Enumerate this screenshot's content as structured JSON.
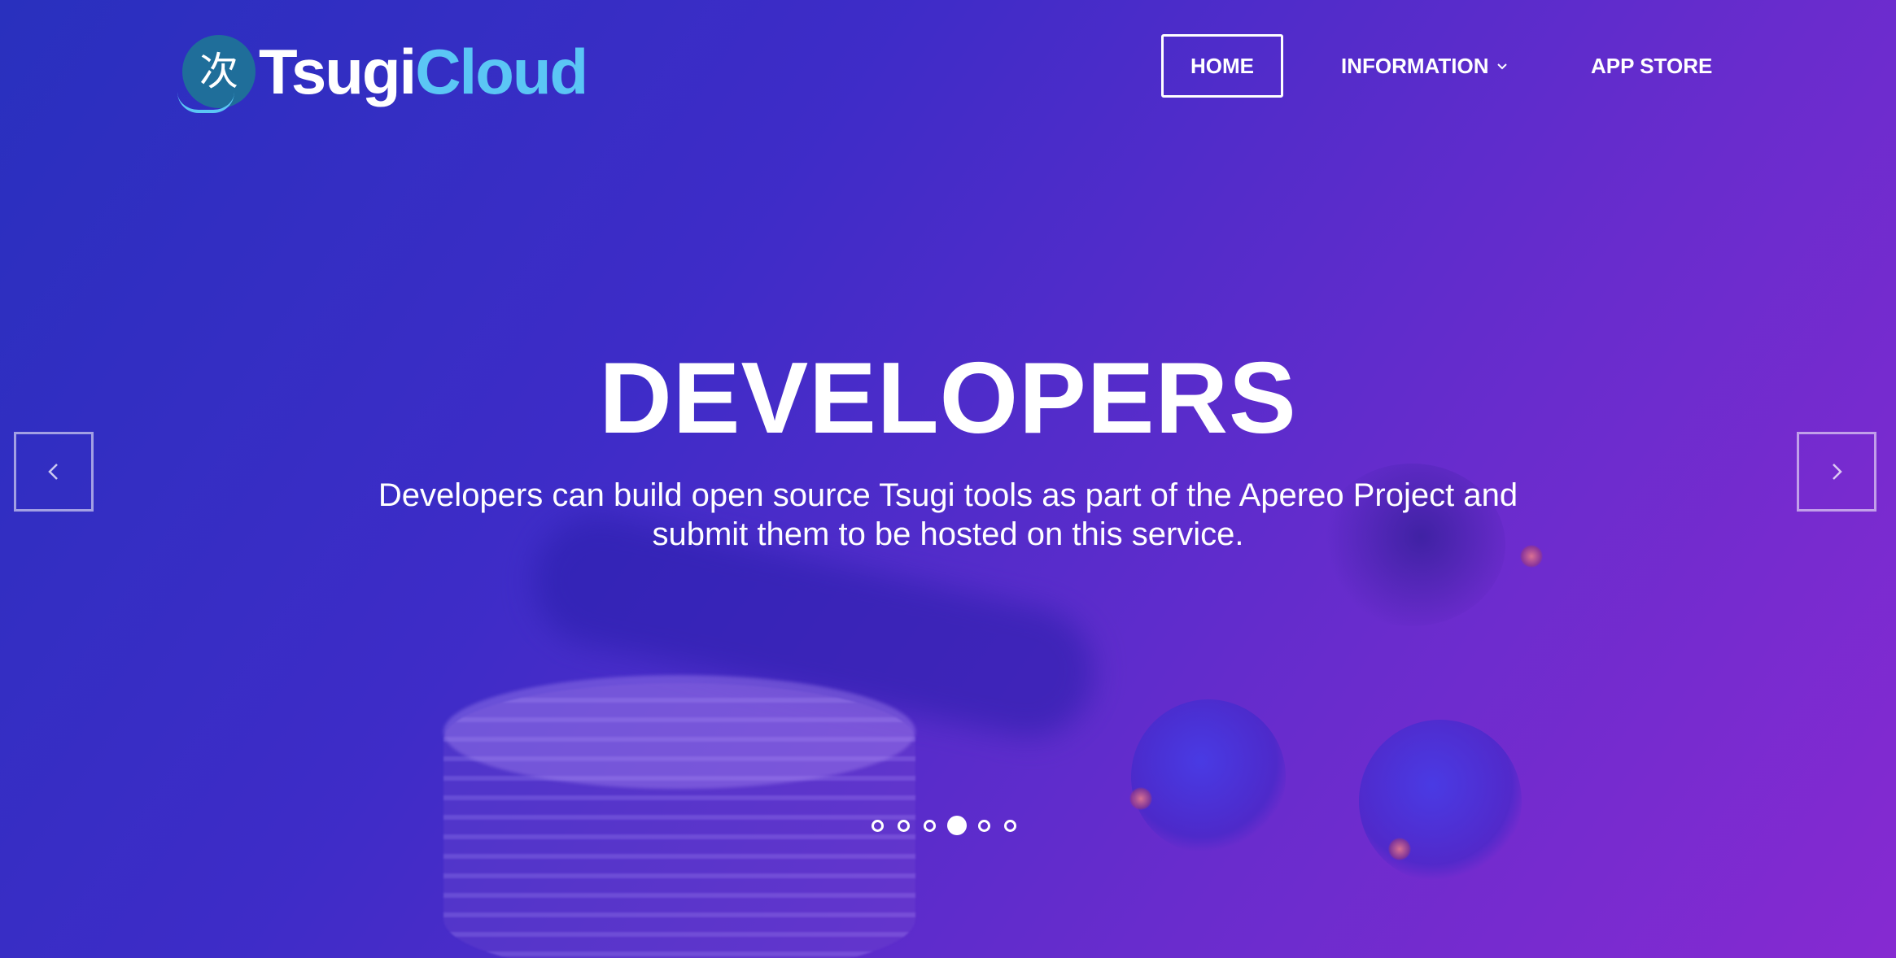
{
  "brand": {
    "logo_glyph": "次",
    "name_part_a": "Tsugi",
    "name_part_b": "Cloud",
    "accent_color": "#5bc6f5"
  },
  "nav": {
    "items": [
      {
        "label": "HOME",
        "active": true
      },
      {
        "label": "INFORMATION",
        "has_dropdown": true,
        "icon": "chevron-down-icon"
      },
      {
        "label": "APP STORE"
      }
    ]
  },
  "slide": {
    "title": "DEVELOPERS",
    "text": "Developers can build open source Tsugi tools as part of the Apereo Project and submit them to be hosted on this service."
  },
  "carousel": {
    "prev_icon": "chevron-left-icon",
    "next_icon": "chevron-right-icon",
    "slide_count": 6,
    "active_index": 4
  },
  "colors": {
    "overlay_start": "#2830be",
    "overlay_end": "#8a2ad2"
  }
}
